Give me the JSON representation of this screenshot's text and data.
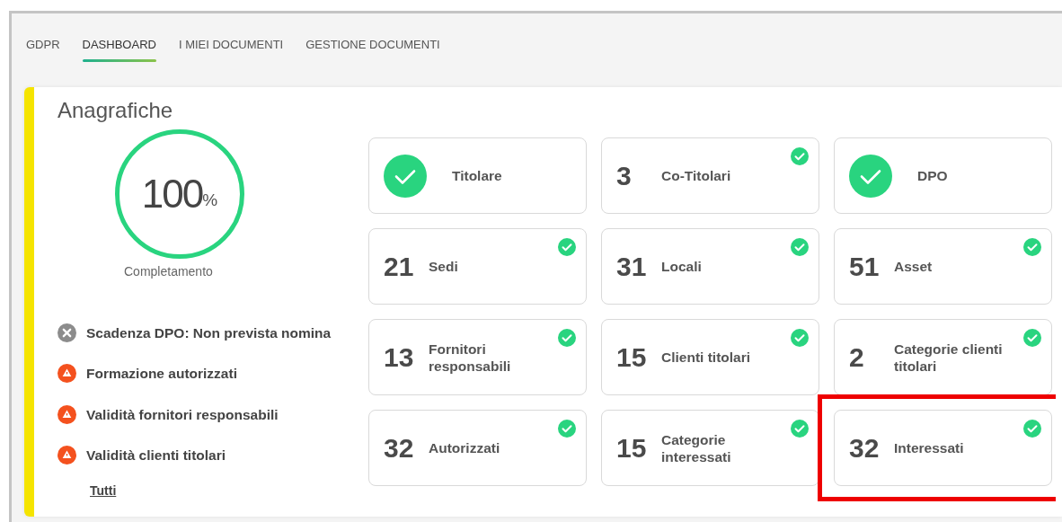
{
  "tabs": [
    {
      "label": "GDPR",
      "selected": false
    },
    {
      "label": "DASHBOARD",
      "selected": true
    },
    {
      "label": "I MIEI DOCUMENTI",
      "selected": false
    },
    {
      "label": "GESTIONE DOCUMENTI",
      "selected": false
    }
  ],
  "card": {
    "title": "Anagrafiche",
    "gauge": {
      "value": "100",
      "unit": "%",
      "caption": "Completamento"
    },
    "alerts": [
      {
        "kind": "error",
        "text": "Scadenza DPO: Non prevista nomina"
      },
      {
        "kind": "warning",
        "text": "Formazione autorizzati"
      },
      {
        "kind": "warning",
        "text": "Validità fornitori responsabili"
      },
      {
        "kind": "warning",
        "text": "Validità clienti titolari"
      }
    ],
    "all_link": "Tutti",
    "tiles": [
      {
        "kind": "check",
        "label": "Titolare",
        "complete": false,
        "highlighted": false
      },
      {
        "kind": "count",
        "count": "3",
        "label": "Co-Titolari",
        "complete": true,
        "highlighted": false
      },
      {
        "kind": "check",
        "label": "DPO",
        "complete": false,
        "highlighted": false
      },
      {
        "kind": "count",
        "count": "21",
        "label": "Sedi",
        "complete": true,
        "highlighted": false
      },
      {
        "kind": "count",
        "count": "31",
        "label": "Locali",
        "complete": true,
        "highlighted": false
      },
      {
        "kind": "count",
        "count": "51",
        "label": "Asset",
        "complete": true,
        "highlighted": false
      },
      {
        "kind": "count",
        "count": "13",
        "label": "Fornitori responsabili",
        "complete": true,
        "highlighted": false
      },
      {
        "kind": "count",
        "count": "15",
        "label": "Clienti titolari",
        "complete": true,
        "highlighted": false
      },
      {
        "kind": "count",
        "count": "2",
        "label": "Categorie clienti titolari",
        "complete": true,
        "highlighted": false
      },
      {
        "kind": "count",
        "count": "32",
        "label": "Autorizzati",
        "complete": true,
        "highlighted": false
      },
      {
        "kind": "count",
        "count": "15",
        "label": "Categorie interessati",
        "complete": true,
        "highlighted": false
      },
      {
        "kind": "count",
        "count": "32",
        "label": "Interessati",
        "complete": true,
        "highlighted": true
      }
    ]
  }
}
